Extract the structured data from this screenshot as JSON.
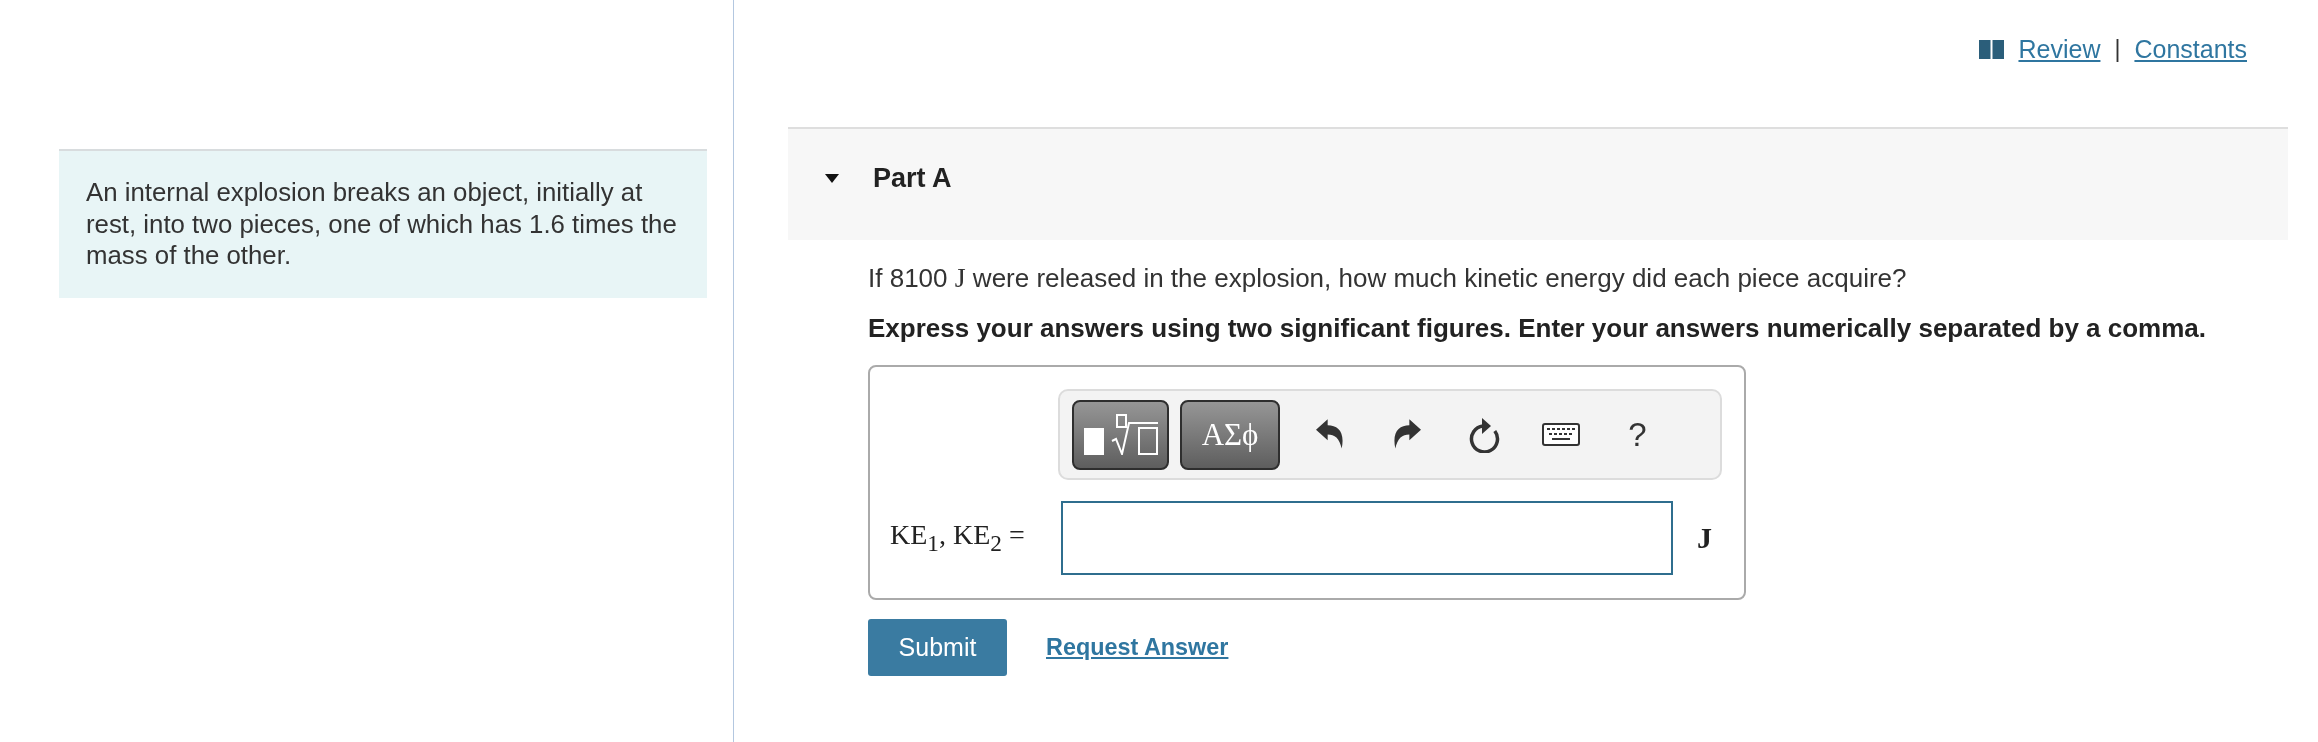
{
  "header_links": {
    "review": "Review",
    "separator": "|",
    "constants": "Constants"
  },
  "problem": {
    "text": "An internal explosion breaks an object, initially at rest, into two pieces, one of which has 1.6 times the mass of the other."
  },
  "part": {
    "title": "Part A",
    "expanded": true,
    "question": {
      "before": "If 8100",
      "unit": "J",
      "after": "were released in the explosion, how much kinetic energy did each piece acquire?"
    },
    "instructions": "Express your answers using two significant figures. Enter your answers numerically separated by a comma.",
    "toolbar": [
      {
        "kind": "templates"
      },
      {
        "kind": "symbols",
        "label": "ΑΣϕ"
      },
      {
        "kind": "undo"
      },
      {
        "kind": "redo"
      },
      {
        "kind": "reset"
      },
      {
        "kind": "keyboard"
      },
      {
        "kind": "help",
        "label": "?"
      }
    ],
    "answer": {
      "label": "KE$_{1}$, KE$_{2}$ =",
      "unit": "J"
    },
    "buttons": {
      "submit": "Submit",
      "request": "Request Answer"
    }
  }
}
